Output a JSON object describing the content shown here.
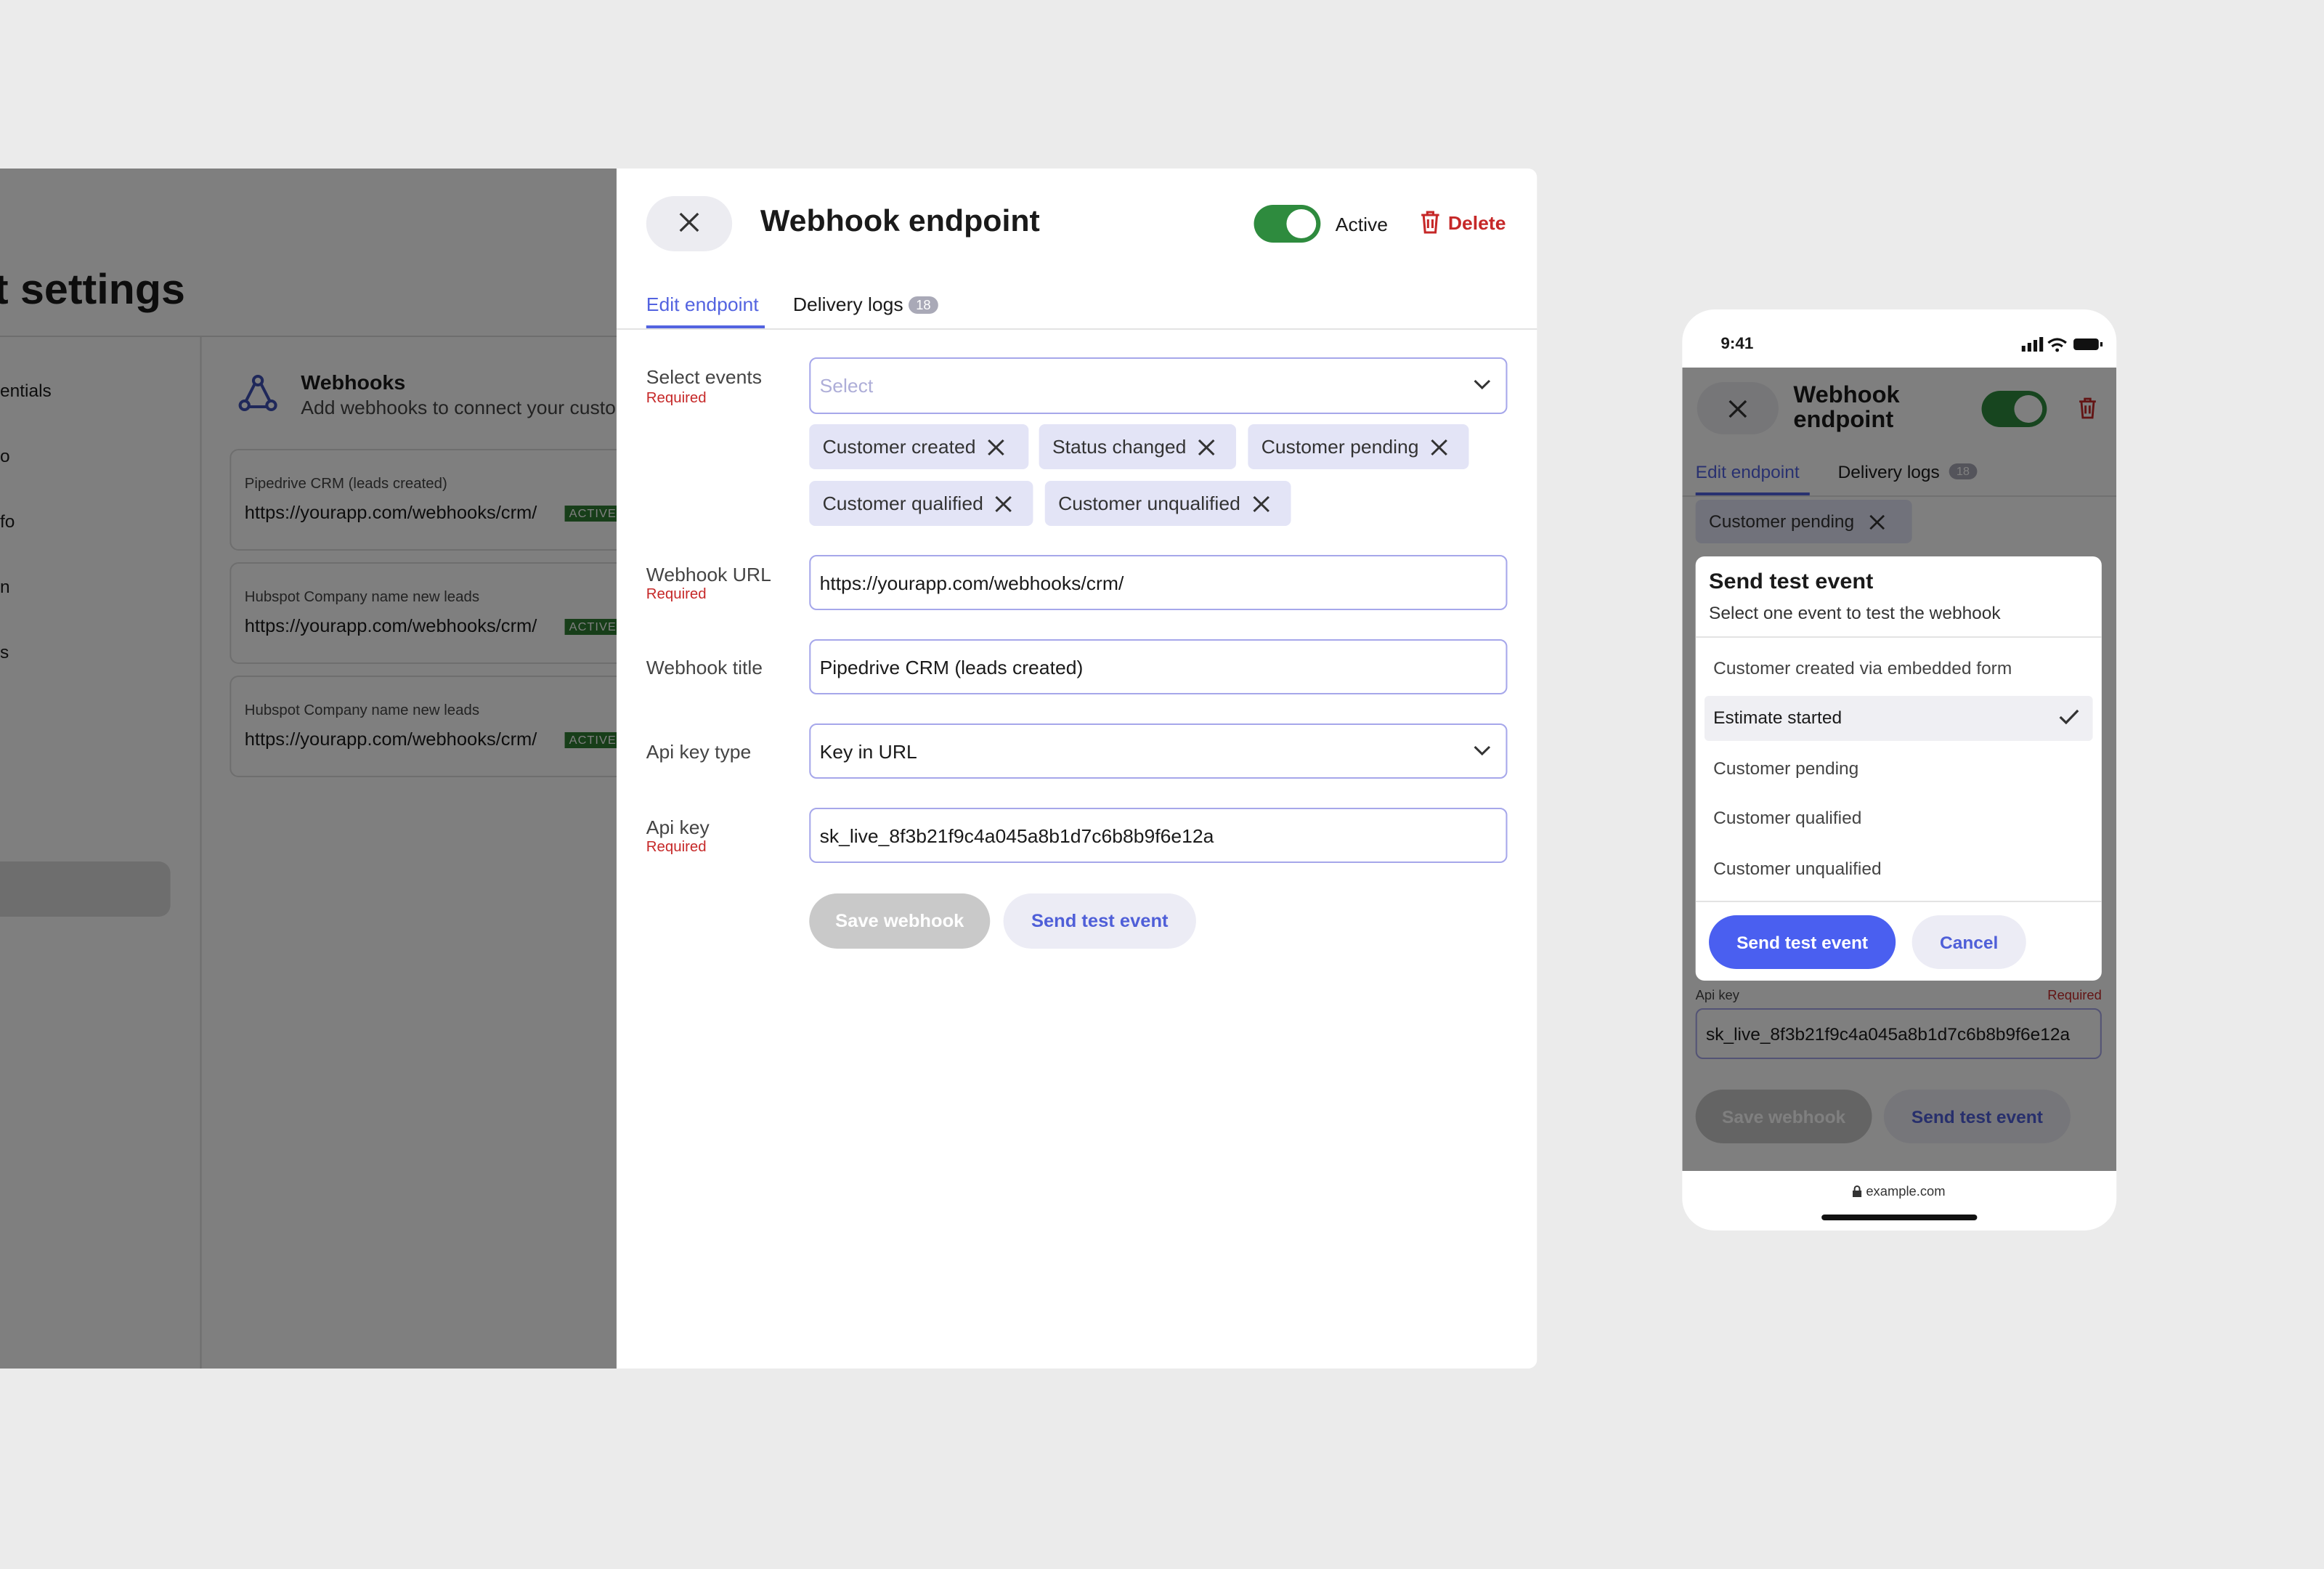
{
  "background_app": {
    "title": "t settings",
    "sidebar": [
      "entials",
      "o",
      "fo",
      "n",
      "s"
    ],
    "webhooks_title": "Webhooks",
    "webhooks_subtitle": "Add webhooks to connect your custo",
    "cards": [
      {
        "name": "Pipedrive CRM (leads created)",
        "url": "https://yourapp.com/webhooks/crm/",
        "badge": "ACTIVE"
      },
      {
        "name": "Hubspot Company name new leads",
        "url": "https://yourapp.com/webhooks/crm/",
        "badge": "ACTIVE"
      },
      {
        "name": "Hubspot Company name new leads",
        "url": "https://yourapp.com/webhooks/crm/",
        "badge": "ACTIVE"
      }
    ]
  },
  "panel": {
    "title": "Webhook endpoint",
    "active_label": "Active",
    "active": true,
    "delete_label": "Delete",
    "tabs": [
      {
        "label": "Edit endpoint",
        "selected": true
      },
      {
        "label": "Delivery logs",
        "badge": "18",
        "selected": false
      }
    ],
    "fields": {
      "events": {
        "label": "Select events",
        "required": "Required",
        "placeholder": "Select",
        "chips": [
          "Customer created",
          "Status changed",
          "Customer pending",
          "Customer qualified",
          "Customer unqualified"
        ]
      },
      "url": {
        "label": "Webhook URL",
        "required": "Required",
        "value": "https://yourapp.com/webhooks/crm/"
      },
      "title": {
        "label": "Webhook title",
        "value": "Pipedrive CRM (leads created)"
      },
      "api_key_type": {
        "label": "Api key type",
        "value": "Key in URL"
      },
      "api_key": {
        "label": "Api key",
        "required": "Required",
        "value": "sk_live_8f3b21f9c4a045a8b1d7c6b8b9f6e12a"
      }
    },
    "save_label": "Save webhook",
    "test_label": "Send test event"
  },
  "phone": {
    "time": "9:41",
    "title": "Webhook endpoint",
    "tabs": [
      {
        "label": "Edit endpoint"
      },
      {
        "label": "Delivery logs",
        "badge": "18"
      }
    ],
    "chip": "Customer pending",
    "modal": {
      "title": "Send test event",
      "subtitle": "Select one event to test the webhook",
      "options": [
        "Customer created via embedded form",
        "Estimate started",
        "Customer pending",
        "Customer qualified",
        "Customer unqualified"
      ],
      "selected": "Estimate started",
      "send_label": "Send test event",
      "cancel_label": "Cancel"
    },
    "api_key_label": "Api key",
    "api_key_required": "Required",
    "api_key_value": "sk_live_8f3b21f9c4a045a8b1d7c6b8b9f6e12a",
    "save_label": "Save webhook",
    "test_label": "Send test event",
    "url_bar": "example.com"
  },
  "colors": {
    "accent": "#5363e0",
    "toggle": "#2e8b3e",
    "danger": "#c62828",
    "chip": "#e3e4f6"
  }
}
